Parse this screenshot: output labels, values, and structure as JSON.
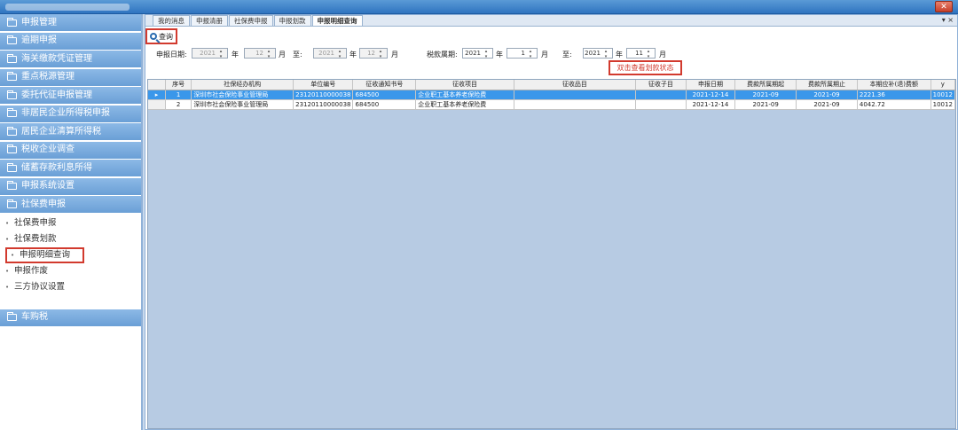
{
  "window": {
    "close_label": "✕"
  },
  "sidebar": {
    "items": [
      "申报管理",
      "逾期申报",
      "海关缴款凭证管理",
      "重点税源管理",
      "委托代征申报管理",
      "非居民企业所得税申报",
      "居民企业清算所得税",
      "税收企业调查",
      "储蓄存款利息所得",
      "申报系统设置",
      "社保费申报"
    ],
    "sub_items": [
      "社保费申报",
      "社保费划款",
      "申报明细查询",
      "申报作废",
      "三方协议设置"
    ],
    "last_item": "车购税"
  },
  "tabs": {
    "items": [
      "我的消息",
      "申报清册",
      "社保费申报",
      "申报划款",
      "申报明细查询"
    ],
    "active_index": 4,
    "menu_arrow": "▾ ×"
  },
  "toolbar": {
    "query_label": "查询"
  },
  "filter": {
    "decl_date_label": "申报日期:",
    "decl_start_year": "2021",
    "decl_start_month": "12",
    "decl_end_year": "2021",
    "decl_end_month": "12",
    "year_unit": "年",
    "month_unit": "月",
    "to_label": "至:",
    "period_label": "税款属期:",
    "period_start_year": "2021",
    "period_start_month": "1",
    "period_end_year": "2021",
    "period_end_month": "11"
  },
  "tip": "双击查看划款状态",
  "table": {
    "columns": [
      "序号",
      "社保经办机构",
      "单位编号",
      "征收通知书号",
      "征收项目",
      "征收品目",
      "征收子目",
      "申报日期",
      "费款所属期起",
      "费款所属期止",
      "本期应补(退)费额",
      "y"
    ],
    "rows": [
      [
        "1",
        "深圳市社会保险事业管理局",
        "23120110000038",
        "684500",
        "企业职工基本养老保险费",
        "",
        "",
        "2021-12-14",
        "2021-09",
        "2021-09",
        "2221.36",
        "10012"
      ],
      [
        "2",
        "深圳市社会保险事业管理局",
        "23120110000038",
        "684500",
        "企业职工基本养老保险费",
        "",
        "",
        "2021-12-14",
        "2021-09",
        "2021-09",
        "4042.72",
        "10012"
      ]
    ],
    "selected_row": 0
  }
}
